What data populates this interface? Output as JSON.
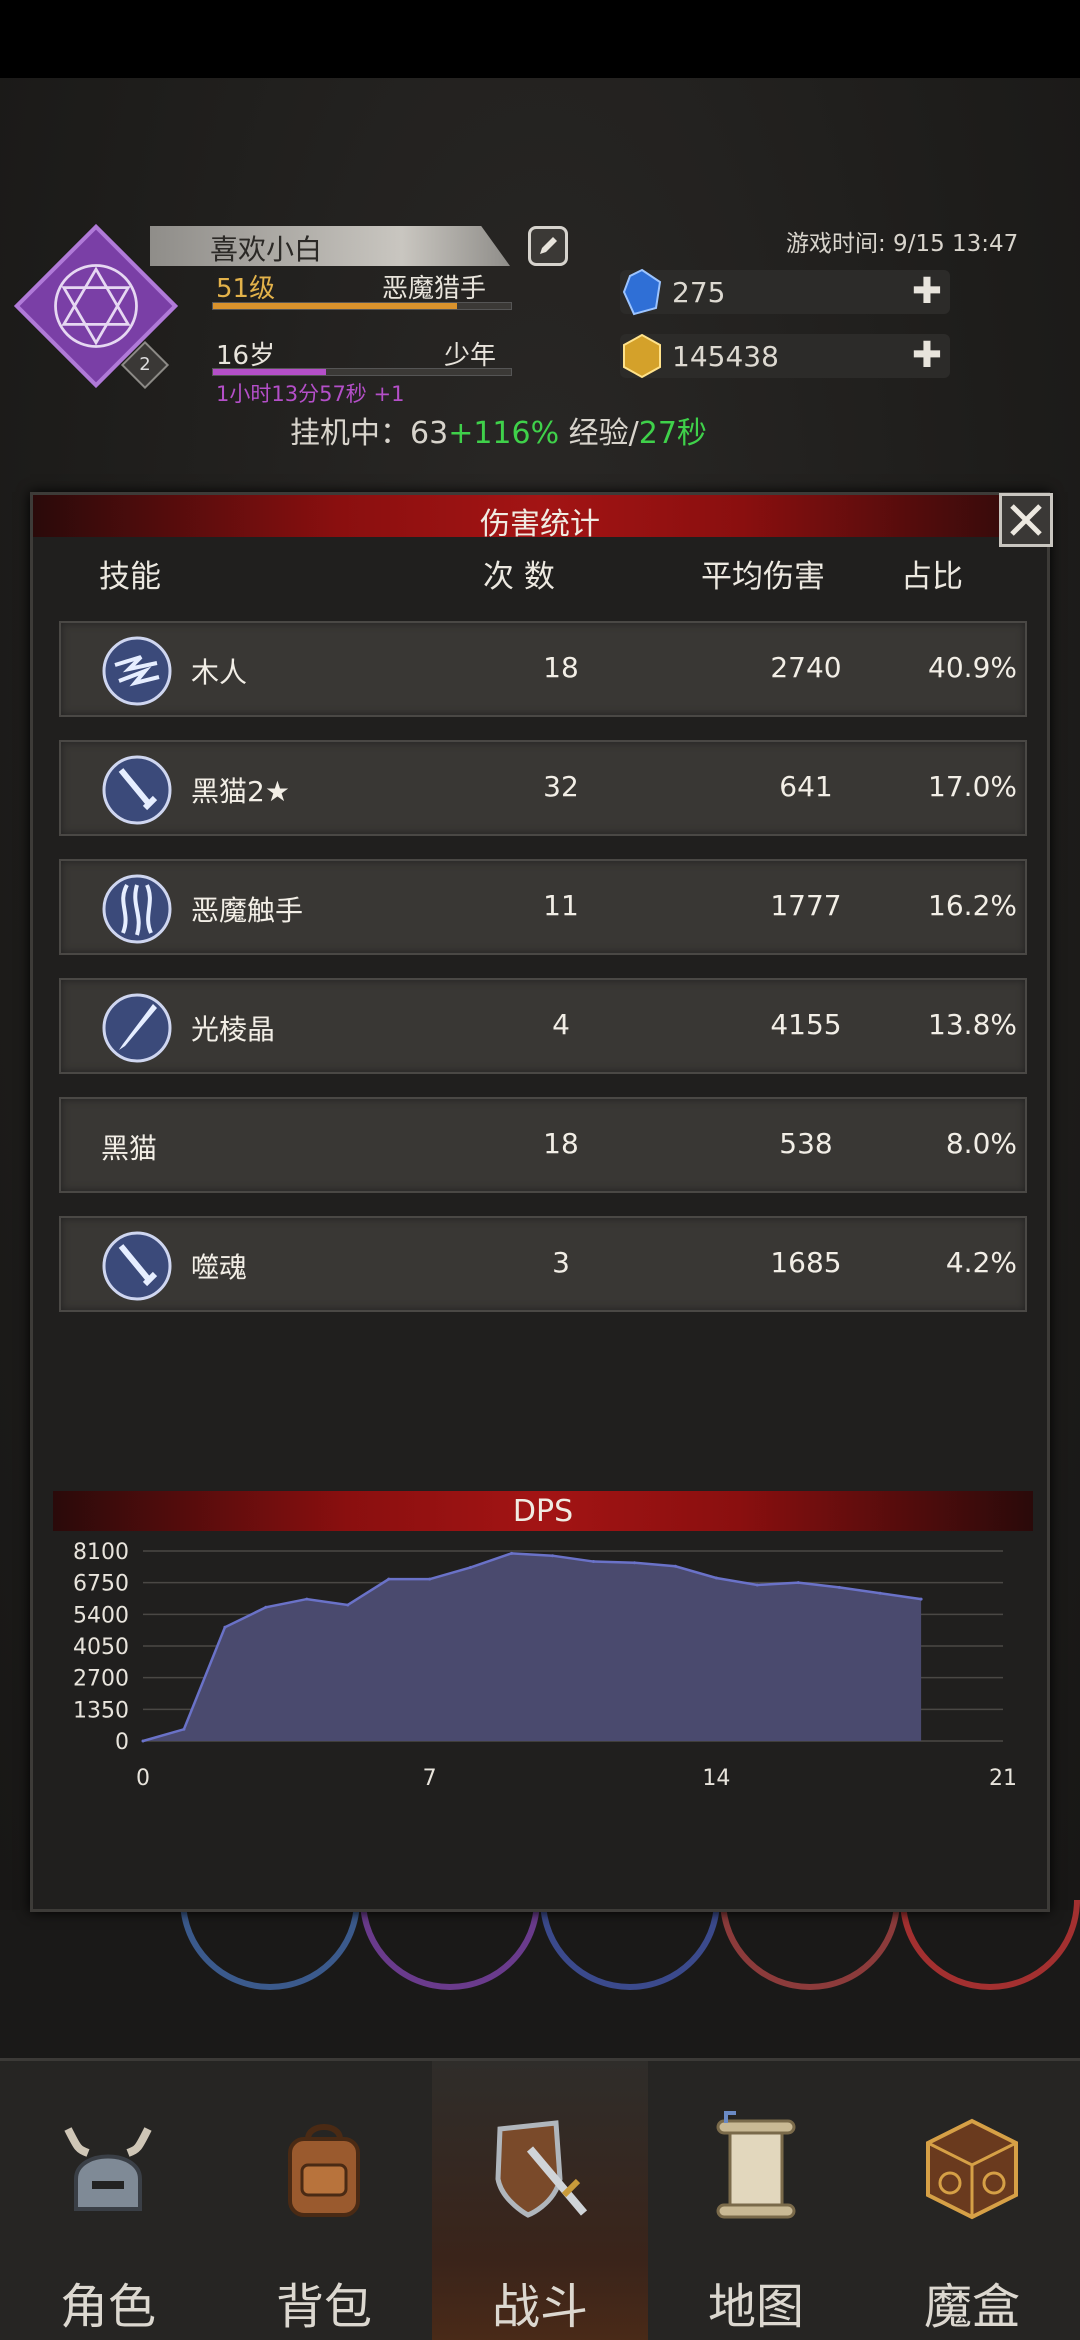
{
  "header": {
    "player_name": "喜欢小白",
    "level": "51级",
    "class": "恶魔猎手",
    "age": "16岁",
    "stage": "少年",
    "age_timer": "1小时13分57秒 +1",
    "idle_label": "挂机中：",
    "idle_value": "63",
    "idle_bonus": "+116%",
    "exp_label": "经验/",
    "exp_time": "27秒",
    "game_time": "游戏时间: 9/15 13:47",
    "avatar_badge": "2",
    "gems": "275",
    "gold": "145438",
    "level_progress": 0.82,
    "age_progress": 0.38,
    "colors": {
      "level": "#e3b24a",
      "age_bar": "#b44fc8",
      "exp_bar": "#d9922c",
      "green": "#3fd14a"
    }
  },
  "dialog": {
    "title": "伤害统计",
    "columns": {
      "skill": "技能",
      "count": "次 数",
      "avg": "平均伤害",
      "ratio": "占比"
    },
    "rows": [
      {
        "name": "木人",
        "count": "18",
        "avg": "2740",
        "ratio": "40.9%",
        "icon": "lightning-icon"
      },
      {
        "name": "黑猫2★",
        "count": "32",
        "avg": "641",
        "ratio": "17.0%",
        "icon": "sword-icon"
      },
      {
        "name": "恶魔触手",
        "count": "11",
        "avg": "1777",
        "ratio": "16.2%",
        "icon": "tentacle-icon"
      },
      {
        "name": "光棱晶",
        "count": "4",
        "avg": "4155",
        "ratio": "13.8%",
        "icon": "light-blade-icon"
      },
      {
        "name": "黑猫",
        "count": "18",
        "avg": "538",
        "ratio": "8.0%",
        "icon": ""
      },
      {
        "name": "噬魂",
        "count": "3",
        "avg": "1685",
        "ratio": "4.2%",
        "icon": "sword-icon"
      }
    ]
  },
  "chart_data": {
    "type": "area",
    "title": "DPS",
    "xlim": [
      0,
      21
    ],
    "ylim": [
      0,
      8100
    ],
    "xticks": [
      "0",
      "7",
      "14",
      "21"
    ],
    "yticks": [
      "8100",
      "6750",
      "5400",
      "4050",
      "2700",
      "1350",
      "0"
    ],
    "grid": true,
    "color": "#4a4a6e",
    "line_color": "#6a72c8",
    "x": [
      0,
      1,
      2,
      3,
      4,
      5,
      6,
      7,
      8,
      9,
      10,
      11,
      12,
      13,
      14,
      15,
      16,
      17,
      18,
      19
    ],
    "y": [
      0,
      500,
      4850,
      5700,
      6050,
      5800,
      6900,
      6900,
      7400,
      8000,
      7900,
      7650,
      7600,
      7450,
      6950,
      6650,
      6750,
      6550,
      6300,
      6050
    ]
  },
  "nav": [
    {
      "label": "角色",
      "icon": "helmet-icon"
    },
    {
      "label": "背包",
      "icon": "backpack-icon"
    },
    {
      "label": "战斗",
      "icon": "shield-sword-icon"
    },
    {
      "label": "地图",
      "icon": "scroll-map-icon"
    },
    {
      "label": "魔盒",
      "icon": "magic-box-icon"
    }
  ]
}
